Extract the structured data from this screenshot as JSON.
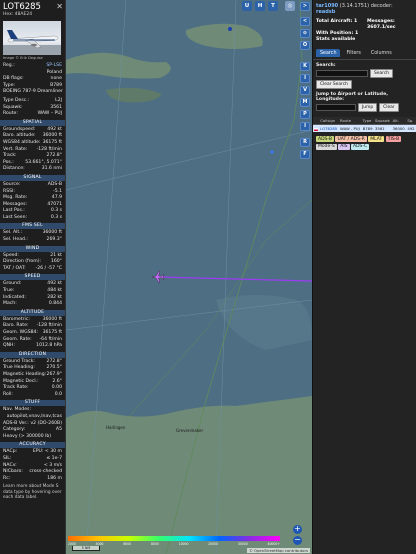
{
  "aircraft": {
    "callsign": "LOT6285",
    "hex_label": "Hex: 48AE24",
    "photo_caption": "Image © Erik Deguise",
    "reg": {
      "k": "Reg.:",
      "v": "SP-LSE"
    },
    "country": "Poland",
    "db_flags": {
      "k": "DB flags:",
      "v": "none"
    },
    "type": {
      "k": "Type:",
      "v": "B789"
    },
    "type_name": "BOEING 787-9 Dreamliner",
    "type_desc": {
      "k": "Type Desc.:",
      "v": "L2J"
    },
    "squawk": {
      "k": "Squawk:",
      "v": "3561"
    },
    "route": {
      "k": "Route:",
      "v": "WAW – PUJ"
    }
  },
  "sections": {
    "spatial": "SPATIAL",
    "signal": "SIGNAL",
    "fms_sel": "FMS SEL",
    "wind": "WIND",
    "speed": "SPEED",
    "altitude": "ALTITUDE",
    "direction": "DIRECTION",
    "stuff": "STUFF",
    "accuracy": "ACCURACY"
  },
  "spatial": [
    {
      "k": "Groundspeed:",
      "v": "492 kt"
    },
    {
      "k": "Baro. altitude:",
      "v": "36000 ft"
    },
    {
      "k": "WGS84 altitude:",
      "v": "36175 ft"
    },
    {
      "k": "Vert. Rate:",
      "v": "-128 ft/min"
    },
    {
      "k": "Track:",
      "v": "272.8°"
    },
    {
      "k": "Pos.:",
      "v": "53.661°, 5.071°"
    },
    {
      "k": "Distance:",
      "v": "31.6 nmi"
    }
  ],
  "signal": [
    {
      "k": "Source:",
      "v": "ADS-B"
    },
    {
      "k": "RSSI:",
      "v": "-5.1"
    },
    {
      "k": "Msg. Rate:",
      "v": "47.9"
    },
    {
      "k": "Messages:",
      "v": "47071"
    },
    {
      "k": "Last Pos.:",
      "v": "0.3 s"
    },
    {
      "k": "Last Seen:",
      "v": "0.3 s"
    }
  ],
  "fms": [
    {
      "k": "Sel. Alt.:",
      "v": "36000 ft"
    },
    {
      "k": "Sel. Head.:",
      "v": "269.3°"
    }
  ],
  "wind": [
    {
      "k": "Speed:",
      "v": "21 kt"
    },
    {
      "k": "Direction (from):",
      "v": "160°"
    },
    {
      "k": "TAT / OAT:",
      "v": "-26 / -57 °C"
    }
  ],
  "speed": [
    {
      "k": "Ground:",
      "v": "492 kt"
    },
    {
      "k": "True:",
      "v": "484 kt"
    },
    {
      "k": "Indicated:",
      "v": "282 kt"
    },
    {
      "k": "Mach:",
      "v": "0.844"
    }
  ],
  "altitude": [
    {
      "k": "Barometric:",
      "v": "36000 ft"
    },
    {
      "k": "Baro. Rate:",
      "v": "-128 ft/min"
    },
    {
      "k": "Geom. WGS84:",
      "v": "36175 ft"
    },
    {
      "k": "Geom. Rate:",
      "v": "-64 ft/min"
    },
    {
      "k": "QNH:",
      "v": "1012.8 hPa"
    }
  ],
  "direction": [
    {
      "k": "Ground Track:",
      "v": "272.8°"
    },
    {
      "k": "True Heading:",
      "v": "270.5°"
    },
    {
      "k": "Magnetic Heading:",
      "v": "267.9°"
    },
    {
      "k": "Magnetic Decl.:",
      "v": "2.6°"
    },
    {
      "k": "Track Rate:",
      "v": "0.00"
    },
    {
      "k": "Roll:",
      "v": "0.0"
    }
  ],
  "stuff": {
    "nav_modes_k": "Nav. Modes:",
    "nav_modes_v": "autopilot,vnav,lnav,tcas",
    "adsb_ver": {
      "k": "ADS-B Ver.:",
      "v": "v2 (DO-260B)"
    },
    "category": {
      "k": "Category:",
      "v": "A5"
    },
    "category_desc": "Heavy (> 300000 lb)"
  },
  "accuracy": [
    {
      "k": "NACp:",
      "v": "EPU: < 30 m"
    },
    {
      "k": "SIL:",
      "v": "≤ 1e-7"
    },
    {
      "k": "NACv:",
      "v": "< 3 m/s"
    },
    {
      "k": "NICbaro:",
      "v": "cross-checked"
    },
    {
      "k": "Rc:",
      "v": "186 m"
    }
  ],
  "footer_text": "Learn more about Mode S data type by hovering over each data label.",
  "map": {
    "buttons": [
      "U",
      "H",
      "T"
    ],
    "places": [
      "Harlingen",
      "Grevenmaker"
    ],
    "scale_label": "5 NM",
    "attribution": "© OpenStreetMap contributors",
    "alt_labels": [
      "2000",
      "4000",
      "6000",
      "8000",
      "10000",
      "20000",
      "30000",
      "40000+"
    ],
    "zoom_in": "+",
    "zoom_out": "−",
    "colors": {
      "sea": "#4b6d82",
      "land": "#6f8a76",
      "track": "#9b3cf3",
      "plane": "#c86cff"
    }
  },
  "side_buttons": [
    "<",
    "⊙",
    "O",
    "K",
    "I",
    "V",
    "M",
    "P",
    "I",
    "R",
    "F"
  ],
  "right": {
    "version_prefix": "tar1090",
    "version": "(3.14.1751) decoder:",
    "readsb": "readsb",
    "total_aircraft": "Total Aircraft: 1",
    "messages": "Messages: 3607.1/sec",
    "with_position": "With Position: 1",
    "stats_label": "Stats available",
    "tabs": [
      "Search",
      "Filters",
      "Columns"
    ],
    "search_label": "Search:",
    "search_button": "Search",
    "clear_search": "Clear Search",
    "jump_label": "Jump to Airport or Latitude, Longitude:",
    "jump_button": "Jump",
    "clear_button": "Clear",
    "table_headers": [
      "Callsign",
      "Route",
      "Type",
      "Squawk",
      "Alt.",
      "Sp."
    ],
    "table_row": [
      "LOT6285",
      "WAW - PUJ",
      "B789",
      "3561",
      "36000",
      "492"
    ],
    "chips": [
      "ADS-B",
      "UAT / ADS-R",
      "MLAT",
      "TIS-B",
      "Mode-S",
      "AIS",
      "ADS-C"
    ],
    "chip_colors": [
      "#c7d57a",
      "#f4c1a8",
      "#f4e28a",
      "#f4a0a0",
      "#d9d9d9",
      "#d9c7f4",
      "#bfeaf0"
    ]
  }
}
